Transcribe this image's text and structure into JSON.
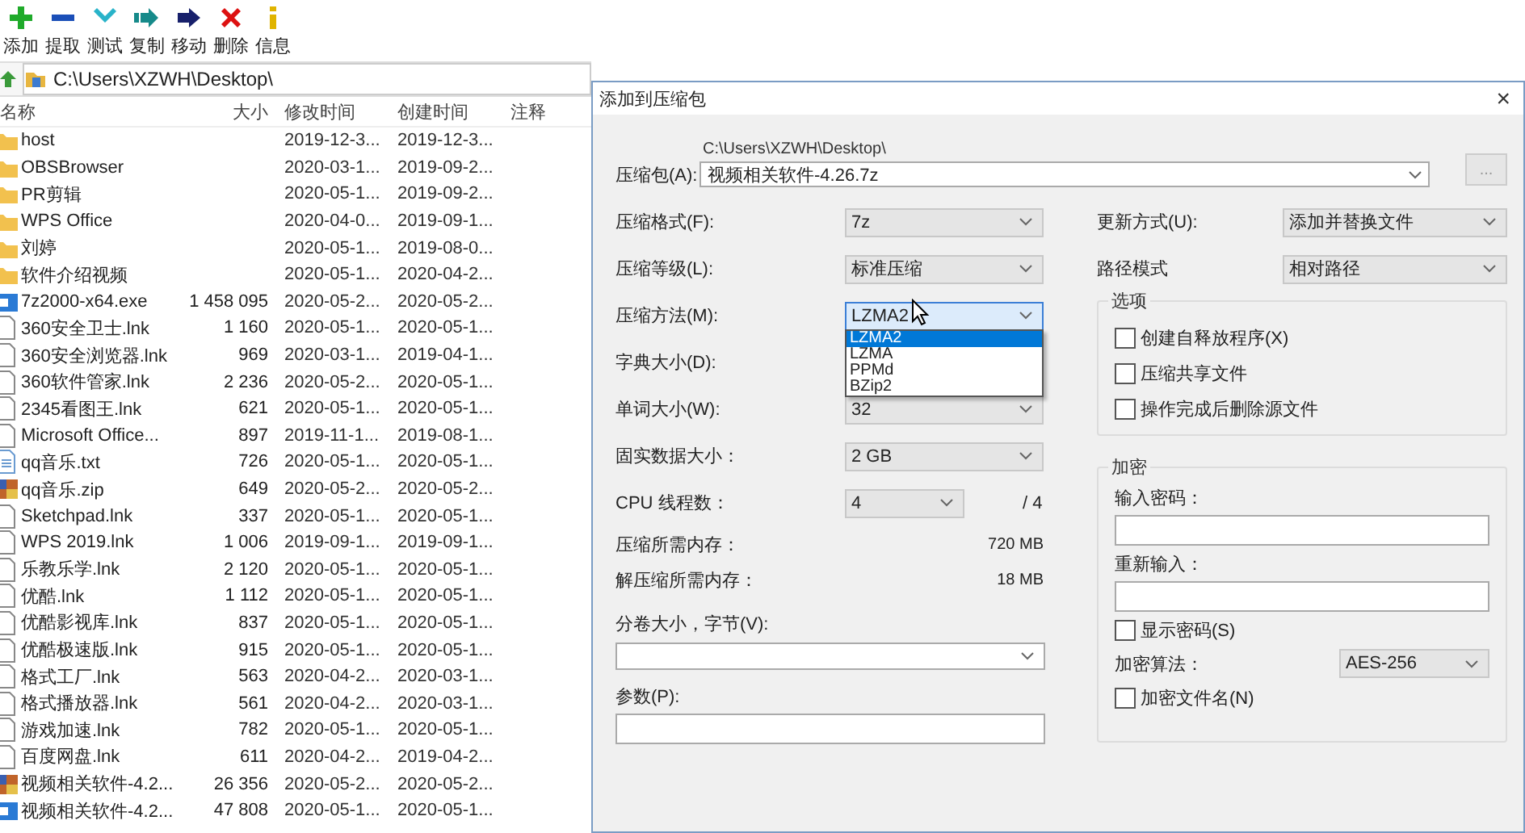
{
  "toolbar": [
    {
      "kind": "add",
      "label": "添加"
    },
    {
      "kind": "extract",
      "label": "提取"
    },
    {
      "kind": "test",
      "label": "测试"
    },
    {
      "kind": "copy",
      "label": "复制"
    },
    {
      "kind": "move",
      "label": "移动"
    },
    {
      "kind": "delete",
      "label": "删除"
    },
    {
      "kind": "info",
      "label": "信息"
    }
  ],
  "address": "C:\\Users\\XZWH\\Desktop\\",
  "file_list": {
    "columns": [
      "名称",
      "大小",
      "修改时间",
      "创建时间",
      "注释"
    ],
    "rows": [
      {
        "kind": "folder",
        "name": "host",
        "modified": "2019-12-3...",
        "created": "2019-12-3..."
      },
      {
        "kind": "folder",
        "name": "OBSBrowser",
        "modified": "2020-03-1...",
        "created": "2019-09-2..."
      },
      {
        "kind": "folder",
        "name": "PR剪辑",
        "modified": "2020-05-1...",
        "created": "2019-09-2..."
      },
      {
        "kind": "folder",
        "name": "WPS Office",
        "modified": "2020-04-0...",
        "created": "2019-09-1..."
      },
      {
        "kind": "folder",
        "name": "刘婷",
        "modified": "2020-05-1...",
        "created": "2019-08-0..."
      },
      {
        "kind": "folder",
        "name": "软件介绍视频",
        "modified": "2020-05-1...",
        "created": "2020-04-2..."
      },
      {
        "kind": "app",
        "name": "7z2000-x64.exe",
        "size": "1 458 095",
        "modified": "2020-05-2...",
        "created": "2020-05-2..."
      },
      {
        "kind": "file",
        "name": "360安全卫士.lnk",
        "size": "1 160",
        "modified": "2020-05-1...",
        "created": "2020-05-1..."
      },
      {
        "kind": "file",
        "name": "360安全浏览器.lnk",
        "size": "969",
        "modified": "2020-03-1...",
        "created": "2019-04-1..."
      },
      {
        "kind": "file",
        "name": "360软件管家.lnk",
        "size": "2 236",
        "modified": "2020-05-2...",
        "created": "2020-05-1..."
      },
      {
        "kind": "file",
        "name": "2345看图王.lnk",
        "size": "621",
        "modified": "2020-05-1...",
        "created": "2020-05-1..."
      },
      {
        "kind": "file",
        "name": "Microsoft Office...",
        "size": "897",
        "modified": "2019-11-1...",
        "created": "2019-08-1..."
      },
      {
        "kind": "text",
        "name": "qq音乐.txt",
        "size": "726",
        "modified": "2020-05-1...",
        "created": "2020-05-1..."
      },
      {
        "kind": "archive",
        "name": "qq音乐.zip",
        "size": "649",
        "modified": "2020-05-2...",
        "created": "2020-05-2..."
      },
      {
        "kind": "file",
        "name": "Sketchpad.lnk",
        "size": "337",
        "modified": "2020-05-1...",
        "created": "2020-05-1..."
      },
      {
        "kind": "file",
        "name": "WPS 2019.lnk",
        "size": "1 006",
        "modified": "2019-09-1...",
        "created": "2019-09-1..."
      },
      {
        "kind": "file",
        "name": "乐教乐学.lnk",
        "size": "2 120",
        "modified": "2020-05-1...",
        "created": "2020-05-1..."
      },
      {
        "kind": "file",
        "name": "优酷.lnk",
        "size": "1 112",
        "modified": "2020-05-1...",
        "created": "2020-05-1..."
      },
      {
        "kind": "file",
        "name": "优酷影视库.lnk",
        "size": "837",
        "modified": "2020-05-1...",
        "created": "2020-05-1..."
      },
      {
        "kind": "file",
        "name": "优酷极速版.lnk",
        "size": "915",
        "modified": "2020-05-1...",
        "created": "2020-05-1..."
      },
      {
        "kind": "file",
        "name": "格式工厂.lnk",
        "size": "563",
        "modified": "2020-04-2...",
        "created": "2020-03-1..."
      },
      {
        "kind": "file",
        "name": "格式播放器.lnk",
        "size": "561",
        "modified": "2020-04-2...",
        "created": "2020-03-1..."
      },
      {
        "kind": "file",
        "name": "游戏加速.lnk",
        "size": "782",
        "modified": "2020-05-1...",
        "created": "2020-05-1..."
      },
      {
        "kind": "file",
        "name": "百度网盘.lnk",
        "size": "611",
        "modified": "2020-04-2...",
        "created": "2019-04-2..."
      },
      {
        "kind": "archive",
        "name": "视频相关软件-4.2...",
        "size": "26 356",
        "modified": "2020-05-2...",
        "created": "2020-05-2..."
      },
      {
        "kind": "app",
        "name": "视频相关软件-4.2...",
        "size": "47 808",
        "modified": "2020-05-1...",
        "created": "2020-05-1..."
      }
    ]
  },
  "dialog": {
    "title": "添加到压缩包",
    "close": "×",
    "archive": {
      "label": "压缩包(A):",
      "folder": "C:\\Users\\XZWH\\Desktop\\",
      "value": "视频相关软件-4.26.7z",
      "browse": "..."
    },
    "settings": [
      {
        "kind": "select",
        "label": "压缩格式(F):",
        "value": "7z"
      },
      {
        "kind": "select",
        "label": "压缩等级(L):",
        "value": "标准压缩"
      },
      {
        "kind": "select",
        "label": "压缩方法(M):",
        "value": "LZMA2",
        "expanded": true,
        "options": [
          {
            "label": "LZMA2",
            "selected": true
          },
          {
            "label": "LZMA",
            "selected": false
          },
          {
            "label": "PPMd",
            "selected": false
          },
          {
            "label": "BZip2",
            "selected": false
          }
        ]
      },
      {
        "kind": "label",
        "label": "字典大小(D):"
      },
      {
        "kind": "select",
        "label": "单词大小(W):",
        "value": "32"
      },
      {
        "kind": "select",
        "label": "固实数据大小：",
        "value": "2 GB"
      },
      {
        "kind": "threads",
        "label": "CPU 线程数：",
        "value": "4",
        "max": "/ 4"
      },
      {
        "kind": "info",
        "label": "压缩所需内存：",
        "value": "720 MB"
      },
      {
        "kind": "info",
        "label": "解压缩所需内存：",
        "value": "18 MB"
      }
    ],
    "volume": {
      "label": "分卷大小，字节(V):"
    },
    "params": {
      "label": "参数(P):"
    },
    "right_settings": [
      {
        "label": "更新方式(U):",
        "value": "添加并替换文件"
      },
      {
        "label": "路径模式",
        "value": "相对路径"
      }
    ],
    "options": {
      "title": "选项",
      "items": [
        {
          "label": "创建自释放程序(X)",
          "checked": false
        },
        {
          "label": "压缩共享文件",
          "checked": false
        },
        {
          "label": "操作完成后删除源文件",
          "checked": false
        }
      ]
    },
    "encryption": {
      "title": "加密",
      "password_label": "输入密码：",
      "reenter_label": "重新输入：",
      "show_password": {
        "label": "显示密码(S)",
        "checked": false
      },
      "method_label": "加密算法：",
      "method": "AES-256",
      "encrypt_names": {
        "label": "加密文件名(N)",
        "checked": false
      }
    }
  }
}
